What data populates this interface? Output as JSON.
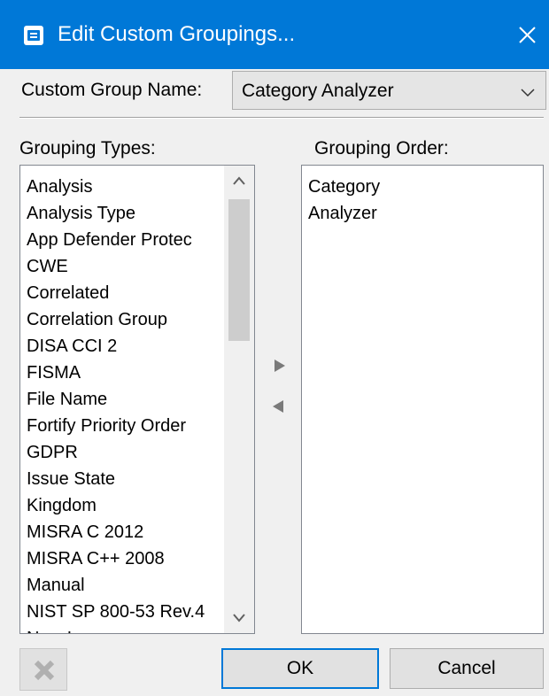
{
  "window": {
    "title": "Edit Custom Groupings...",
    "accent_color": "#0078d7",
    "icon": "app-dialog-icon",
    "close_icon": "close-icon"
  },
  "group_name": {
    "label": "Custom Group Name:",
    "value": "Category Analyzer"
  },
  "grouping_types": {
    "header": "Grouping Types:",
    "items": [
      "Analysis",
      "Analysis Type",
      "App Defender Protec",
      "CWE",
      "Correlated",
      "Correlation Group",
      "DISA CCI 2",
      "FISMA",
      "File Name",
      "Fortify Priority Order",
      "GDPR",
      "Issue State",
      "Kingdom",
      "MISRA C 2012",
      "MISRA C++ 2008",
      "Manual",
      "NIST SP 800-53 Rev.4",
      "New Issue"
    ]
  },
  "grouping_order": {
    "header": "Grouping Order:",
    "items": [
      "Category",
      "Analyzer"
    ]
  },
  "move_buttons": {
    "right_icon": "arrow-right-icon",
    "left_icon": "arrow-left-icon"
  },
  "buttons": {
    "delete_icon": "delete-x-icon",
    "ok": "OK",
    "cancel": "Cancel"
  }
}
